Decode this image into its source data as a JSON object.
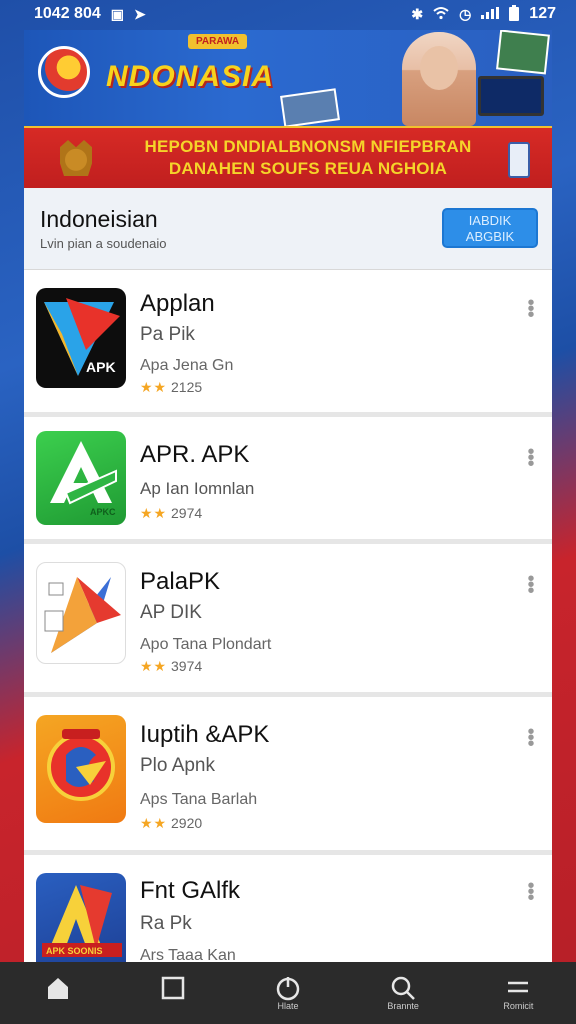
{
  "status_bar": {
    "time": "1042 804",
    "left_icons": [
      "notification-icon",
      "cast-icon"
    ],
    "right_text": "127",
    "right_icons": [
      "bluetooth-icon",
      "wifi-icon",
      "alarm-icon",
      "signal-icon",
      "battery-icon"
    ]
  },
  "banner": {
    "tag": "PARAWA",
    "title": "NDONASIA"
  },
  "red_strip": {
    "line1": "HEPOBN DNDIALBNONSM NFIEPBRAN",
    "line2": "DANAHEN SOUFS REUA NGHOIA"
  },
  "section": {
    "title": "Indoneisian",
    "subtitle": "Lvin pian a soudenaio",
    "button_line1": "IABDIK",
    "button_line2": "ABGBIK"
  },
  "apps": [
    {
      "name": "Applan",
      "type": "Pa Pik",
      "desc": "Apa Jena Gn",
      "stars": "★★",
      "rating": "2125",
      "icon_label": "APK",
      "icon": "triangle-logo-icon"
    },
    {
      "name": "APR. APK",
      "type": "Ap Ian Iomnlan",
      "desc": "",
      "stars": "★★",
      "rating": "2974",
      "icon_label": "APKC",
      "icon": "green-a-logo-icon"
    },
    {
      "name": "PalaPK",
      "type": "AP DIK",
      "desc": "Apo Tana Plondart",
      "stars": "★★",
      "rating": "3974",
      "icon_label": "",
      "icon": "colorful-triangle-icon"
    },
    {
      "name": "Iuptih &APK",
      "type": "Plo Apnk",
      "desc": "Aps Tana Barlah",
      "stars": "★★",
      "rating": "2920",
      "icon_label": "",
      "icon": "emblem-logo-icon"
    },
    {
      "name": "Fnt GAlfk",
      "type": "Ra Pk",
      "desc": "Ars Taaa Kan",
      "stars": "",
      "rating": "",
      "icon_label": "APK SOONIS",
      "icon": "red-a-logo-icon"
    }
  ],
  "nav": [
    {
      "label": "",
      "icon": "home-icon"
    },
    {
      "label": "",
      "icon": "square-icon"
    },
    {
      "label": "Hlate",
      "icon": "power-icon"
    },
    {
      "label": "Brannte",
      "icon": "search-icon"
    },
    {
      "label": "Romicit",
      "icon": "menu-icon"
    }
  ],
  "colors": {
    "accent_blue": "#2d8ee8",
    "banner_red": "#c01f1f",
    "banner_yellow": "#f5d42a",
    "star_orange": "#f5a623"
  }
}
